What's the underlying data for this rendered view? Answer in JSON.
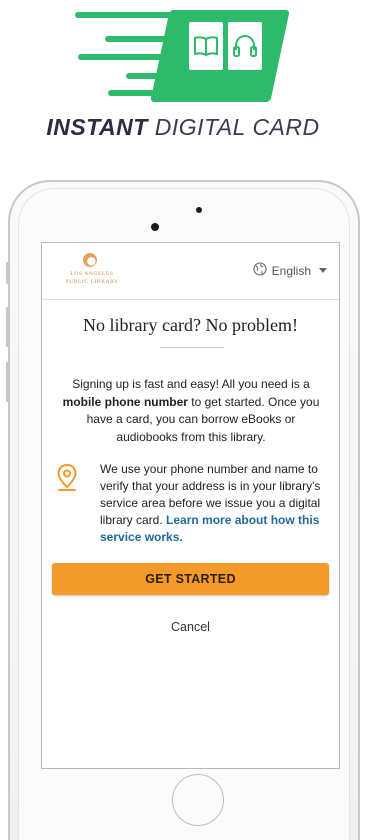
{
  "hero": {
    "title_bold": "INSTANT",
    "title_light": "DIGITAL CARD",
    "brand_color": "#2dba6a",
    "icons": [
      "book-icon",
      "headphones-icon"
    ]
  },
  "device": {
    "frame": "smartphone"
  },
  "screen": {
    "logo_lines": [
      "LOS ANGELES",
      "PUBLIC LIBRARY"
    ],
    "language": {
      "icon": "globe-icon",
      "selected": "English"
    },
    "headline": "No library card? No problem!",
    "intro": {
      "before": "Signing up is fast and easy! All you need is a ",
      "bold": "mobile phone number",
      "after": " to get started. Once you have a card, you can borrow eBooks or audiobooks from this library."
    },
    "verify": {
      "icon": "location-pin-icon",
      "text": "We use your phone number and name to verify that your address is in your library's service area before we issue you a digital library card. ",
      "link": "Learn more about how this service works."
    },
    "cta_label": "GET STARTED",
    "cta_color": "#f39a2b",
    "cancel_label": "Cancel",
    "link_color": "#1f6a9e"
  }
}
